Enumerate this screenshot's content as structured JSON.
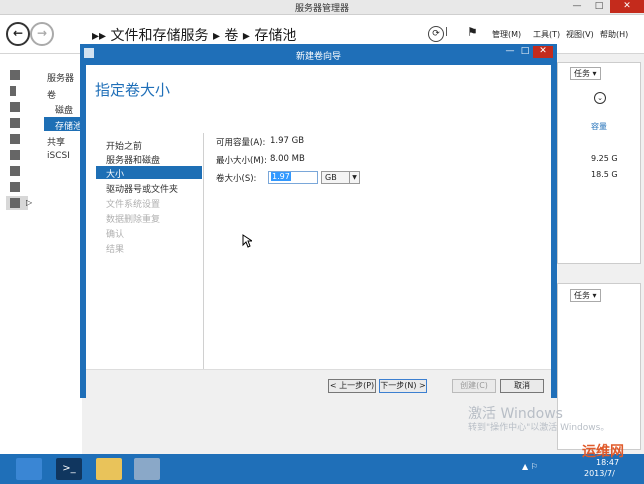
{
  "window": {
    "title": "服务器管理器",
    "controls": {
      "minimize": "—",
      "maximize": "□",
      "close": "✕"
    }
  },
  "toolbar": {
    "breadcrumb": "▸▸ 文件和存储服务 ▸ 卷 ▸ 存储池",
    "menus": [
      "管理(M)",
      "工具(T)",
      "视图(V)",
      "帮助(H)"
    ]
  },
  "tree": {
    "items": [
      "服务器",
      "卷",
      "磁盘",
      "存储池",
      "共享",
      "iSCSI"
    ],
    "selected_index": 3
  },
  "right_pane": {
    "task_label": "任务",
    "column_header": "容量",
    "values": [
      "9.25 G",
      "18.5 G"
    ],
    "task_label_2": "任务"
  },
  "dialog": {
    "title": "新建卷向导",
    "heading": "指定卷大小",
    "steps": [
      {
        "label": "开始之前",
        "enabled": true
      },
      {
        "label": "服务器和磁盘",
        "enabled": true
      },
      {
        "label": "大小",
        "enabled": true,
        "selected": true
      },
      {
        "label": "驱动器号或文件夹",
        "enabled": true
      },
      {
        "label": "文件系统设置",
        "enabled": false
      },
      {
        "label": "数据删除重复",
        "enabled": false
      },
      {
        "label": "确认",
        "enabled": false
      },
      {
        "label": "结果",
        "enabled": false
      }
    ],
    "fields": {
      "available_label": "可用容量(A):",
      "available_value": "1.97 GB",
      "min_label": "最小大小(M):",
      "min_value": "8.00 MB",
      "size_label": "卷大小(S):",
      "size_value": "1.97",
      "unit": "GB"
    },
    "buttons": {
      "prev": "< 上一步(P)",
      "next": "下一步(N) >",
      "create": "创建(C)",
      "cancel": "取消"
    }
  },
  "watermark": {
    "line1": "激活 Windows",
    "line2": "转到\"操作中心\"以激活 Windows。"
  },
  "taskbar": {
    "time": "18:47",
    "date": "2013/7/"
  },
  "logo_text": "运维网"
}
